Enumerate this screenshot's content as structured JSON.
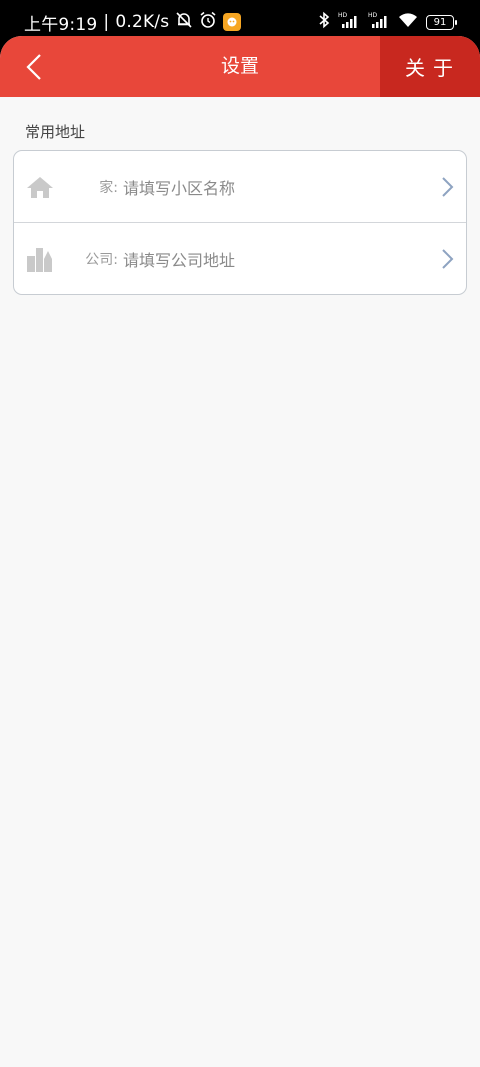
{
  "status_bar": {
    "time": "上午9:19",
    "separator": "|",
    "network_speed": "0.2K/s",
    "battery_level": "91",
    "icons": [
      "mute-bell-icon",
      "alarm-icon",
      "app-notification-icon",
      "bluetooth-icon",
      "signal-hd-icon",
      "signal-hd-icon",
      "wifi-icon",
      "battery-icon"
    ]
  },
  "navbar": {
    "back_icon": "chevron-left-icon",
    "title": "设置",
    "about_label": "关于",
    "background": "#e8473a",
    "about_background": "#c8281f"
  },
  "section": {
    "title": "常用地址"
  },
  "addresses": [
    {
      "icon": "home-icon",
      "label": "家:",
      "placeholder": "请填写小区名称"
    },
    {
      "icon": "office-building-icon",
      "label": "公司:",
      "placeholder": "请填写公司地址"
    }
  ],
  "colors": {
    "page_background": "#f8f8f8",
    "chevron": "#8ea3c1",
    "icon_gray": "#c9c9c9"
  }
}
